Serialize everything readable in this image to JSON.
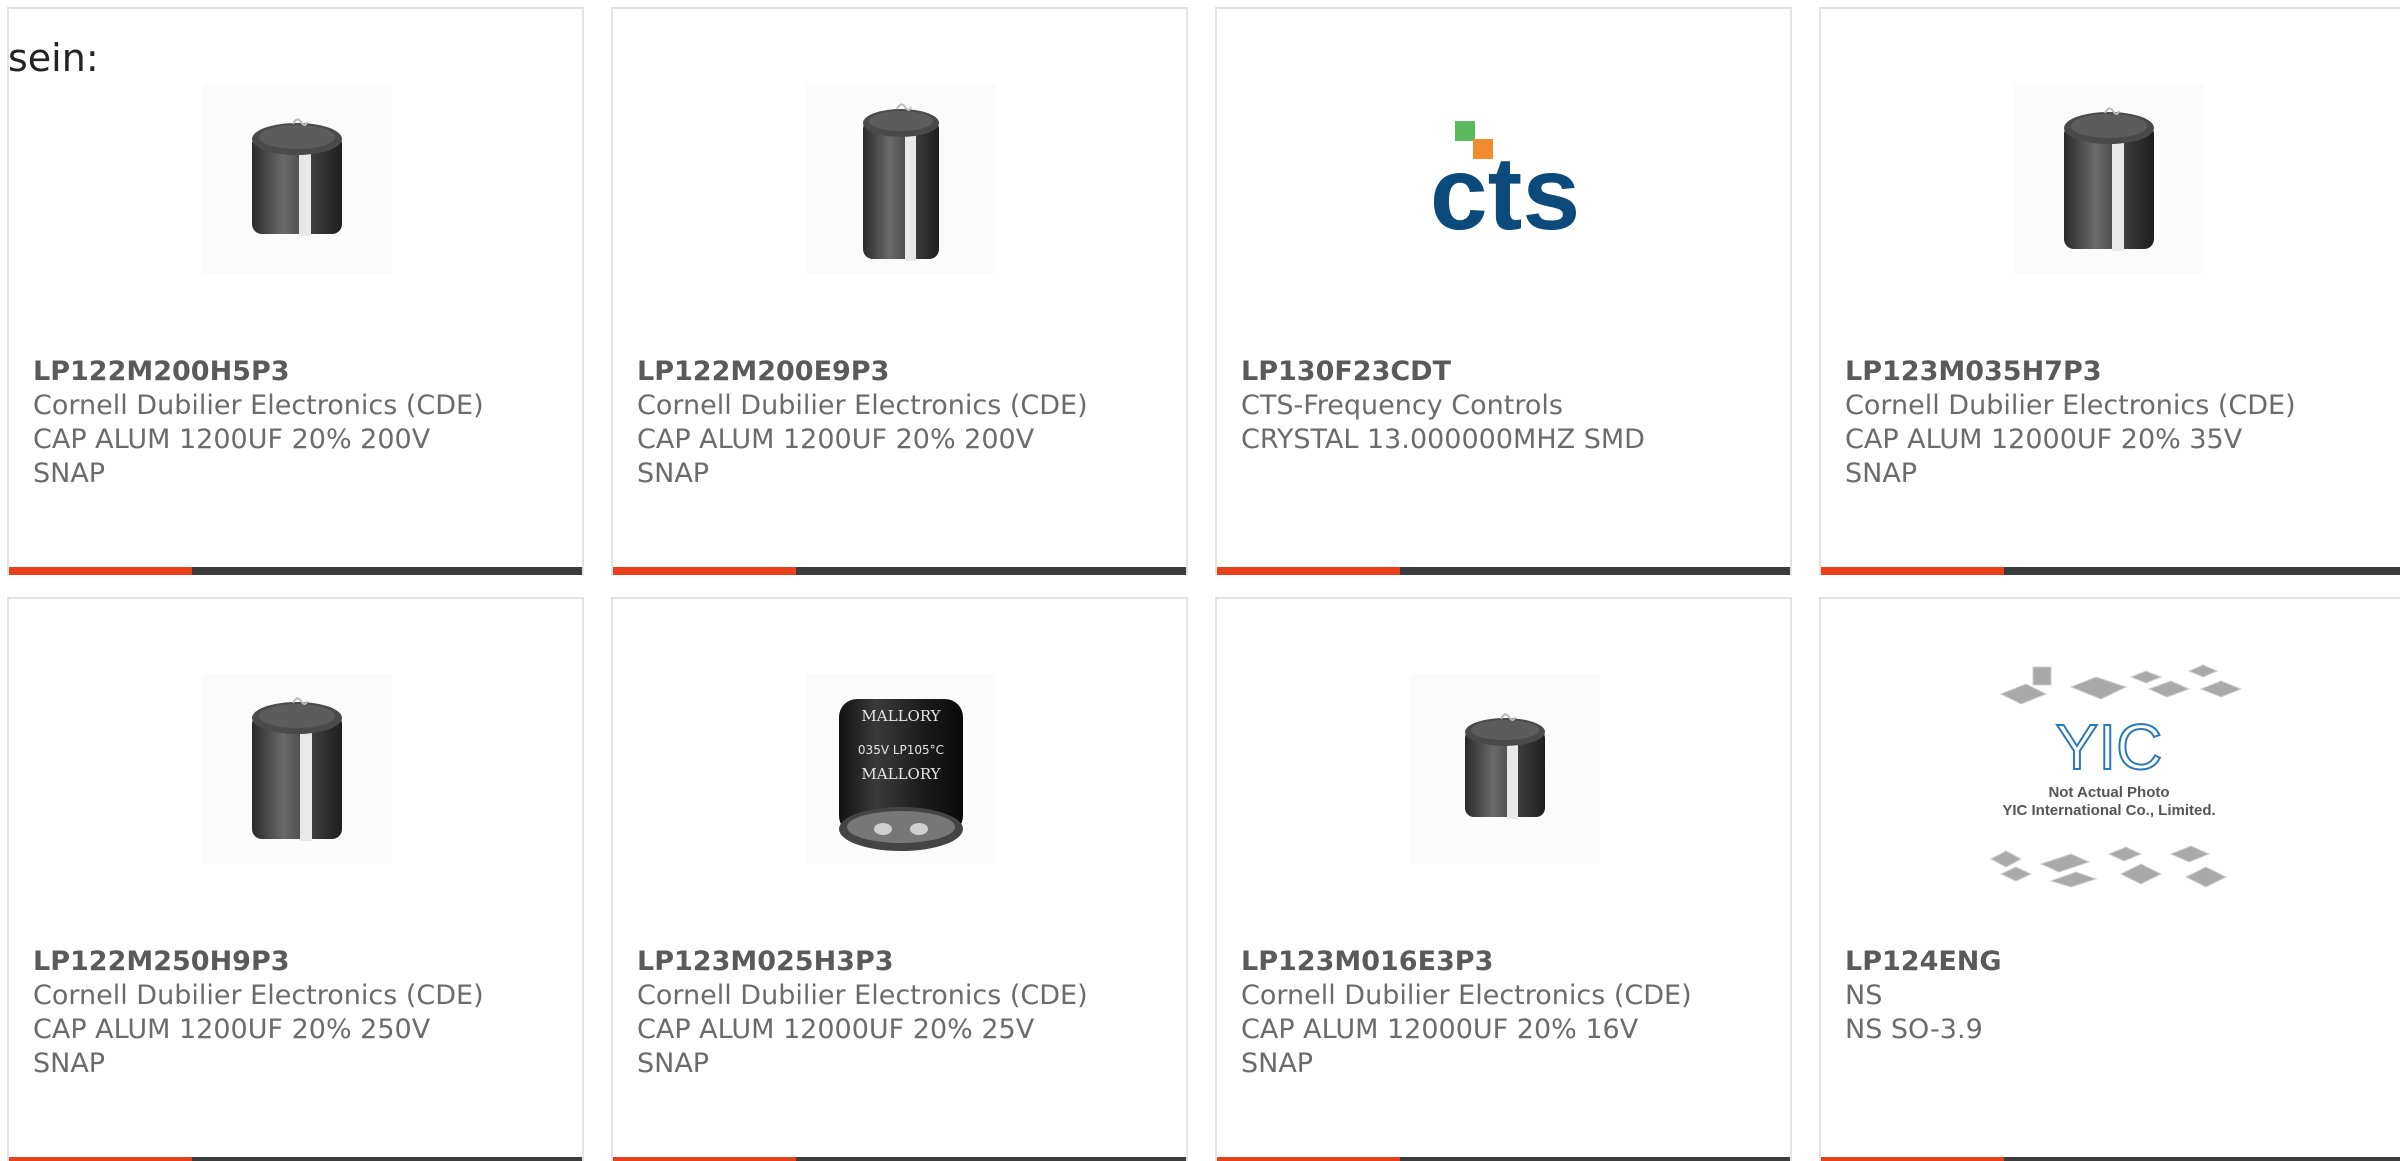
{
  "lead_text": "sein:",
  "accent_color": "#e8401c",
  "bar_color": "#3c3c3c",
  "products": [
    {
      "part_number": "LP122M200H5P3",
      "manufacturer": "Cornell Dubilier Electronics (CDE)",
      "desc1": "CAP ALUM 1200UF 20% 200V",
      "desc2": "SNAP",
      "image": "capacitor-short-icon"
    },
    {
      "part_number": "LP122M200E9P3",
      "manufacturer": "Cornell Dubilier Electronics (CDE)",
      "desc1": "CAP ALUM 1200UF 20% 200V",
      "desc2": "SNAP",
      "image": "capacitor-tall-icon"
    },
    {
      "part_number": "LP130F23CDT",
      "manufacturer": "CTS-Frequency Controls",
      "desc1": "CRYSTAL 13.000000MHZ SMD",
      "desc2": "",
      "image": "cts-logo",
      "logo_text": "cts"
    },
    {
      "part_number": "LP123M035H7P3",
      "manufacturer": "Cornell Dubilier Electronics (CDE)",
      "desc1": "CAP ALUM 12000UF 20% 35V",
      "desc2": "SNAP",
      "image": "capacitor-tall-icon"
    },
    {
      "part_number": "LP122M250H9P3",
      "manufacturer": "Cornell Dubilier Electronics (CDE)",
      "desc1": "CAP ALUM 1200UF 20% 250V",
      "desc2": "SNAP",
      "image": "capacitor-tall-icon"
    },
    {
      "part_number": "LP123M025H3P3",
      "manufacturer": "Cornell Dubilier Electronics (CDE)",
      "desc1": "CAP ALUM 12000UF 20% 25V",
      "desc2": "SNAP",
      "image": "mallory-capacitor-photo",
      "photo_text": [
        "MALLORY",
        "035V LP105°C",
        "MALLORY"
      ]
    },
    {
      "part_number": "LP123M016E3P3",
      "manufacturer": "Cornell Dubilier Electronics (CDE)",
      "desc1": "CAP ALUM 12000UF 20% 16V",
      "desc2": "SNAP",
      "image": "capacitor-short-icon"
    },
    {
      "part_number": "LP124ENG",
      "manufacturer": "NS",
      "desc1": "NS SO-3.9",
      "desc2": "",
      "image": "yic-placeholder",
      "placeholder_lines": [
        "YIC",
        "Not Actual Photo",
        "YIC International Co., Limited."
      ]
    }
  ]
}
